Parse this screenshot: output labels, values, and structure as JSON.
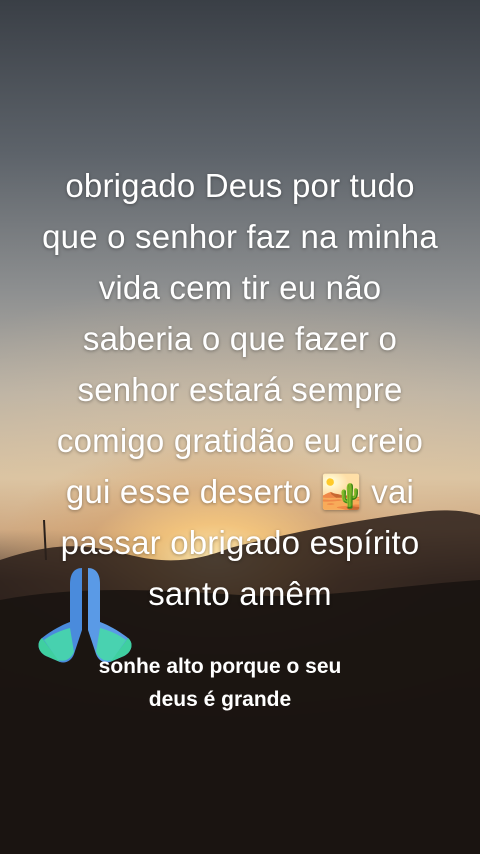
{
  "post": {
    "caption_lines": [
      "obrigado Deus por tudo",
      "que o senhor faz na minha",
      "vida cem tir eu não",
      "saberia o que fazer o",
      "senhor estará sempre",
      "comigo gratidão eu creio",
      "gui esse deserto 🏜️  vai",
      "passar obrigado espírito",
      "santo amêm"
    ],
    "subtitle_lines": [
      "sonhe alto porque o seu",
      "deus é grande"
    ],
    "sticker": "praying-hands-icon"
  }
}
